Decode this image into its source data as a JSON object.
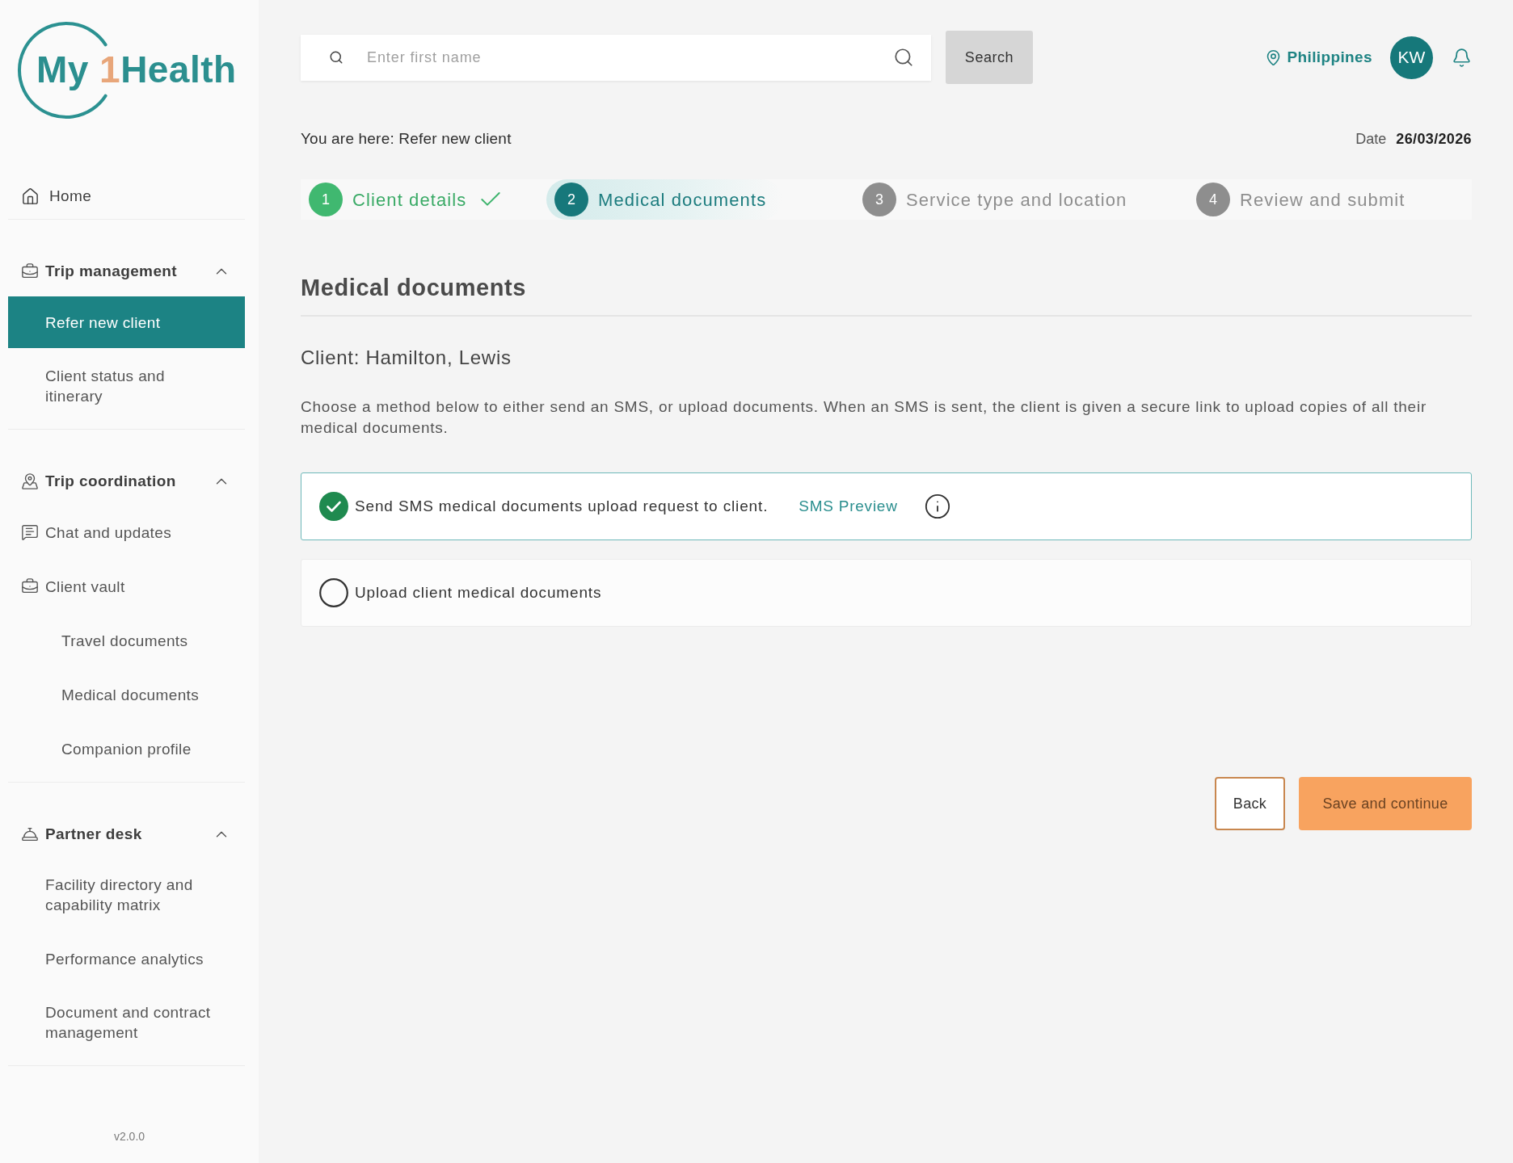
{
  "logo": {
    "first": "My",
    "accent": "1",
    "rest": "Health"
  },
  "sidebar": {
    "sections": [
      {
        "kind": "link",
        "label": "Home",
        "selected": false
      },
      {
        "kind": "group",
        "label": "Trip management",
        "expanded": true,
        "items": [
          {
            "kind": "link",
            "label": "Refer new client",
            "selected": true
          },
          {
            "kind": "link",
            "label": "Client status and itinerary",
            "selected": false
          }
        ]
      },
      {
        "kind": "group",
        "label": "Trip coordination",
        "expanded": true,
        "items": [
          {
            "kind": "icon_link",
            "label": "Chat and updates",
            "selected": false
          },
          {
            "kind": "icon_link",
            "label": "Client vault",
            "selected": false,
            "children": [
              {
                "label": "Travel documents",
                "selected": false
              },
              {
                "label": "Medical documents",
                "selected": false
              },
              {
                "label": "Companion profile",
                "selected": false
              }
            ]
          }
        ]
      },
      {
        "kind": "group",
        "label": "Partner desk",
        "expanded": true,
        "items": [
          {
            "kind": "link",
            "label": "Facility directory and capability matrix",
            "selected": false
          },
          {
            "kind": "link",
            "label": "Performance analytics",
            "selected": false
          },
          {
            "kind": "link",
            "label": "Document and contract management",
            "selected": false
          }
        ]
      }
    ],
    "version": "v2.0.0"
  },
  "header": {
    "search": {
      "placeholder": "Enter first name"
    },
    "search_button": "Search",
    "location": "Philippines",
    "avatar": "KW"
  },
  "breadcrumb": "You are here: Refer new client",
  "date": {
    "label": "Date",
    "value": "26/03/2026"
  },
  "stepper": {
    "steps": [
      {
        "number": "1",
        "label": "Client details",
        "kind": "complete"
      },
      {
        "number": "2",
        "label": "Medical documents",
        "kind": "current"
      },
      {
        "number": "3",
        "label": "Service type and location",
        "kind": "upcoming"
      },
      {
        "number": "4",
        "label": "Review and submit",
        "kind": "upcoming"
      }
    ]
  },
  "page": {
    "title": "Medical documents",
    "client": "Client: Hamilton, Lewis",
    "instructions": "Choose a method below to either send an SMS, or upload documents. When an SMS is sent, the client is given a secure link to upload copies of all their medical documents."
  },
  "options": [
    {
      "label": "Send SMS medical documents upload request to client.",
      "selected": true,
      "link": "SMS Preview",
      "info": true
    },
    {
      "label": "Upload client medical documents",
      "selected": false,
      "info": false
    }
  ],
  "actions": [
    {
      "label": "Back",
      "kind": "secondary"
    },
    {
      "label": "Save and continue",
      "kind": "primary"
    }
  ]
}
